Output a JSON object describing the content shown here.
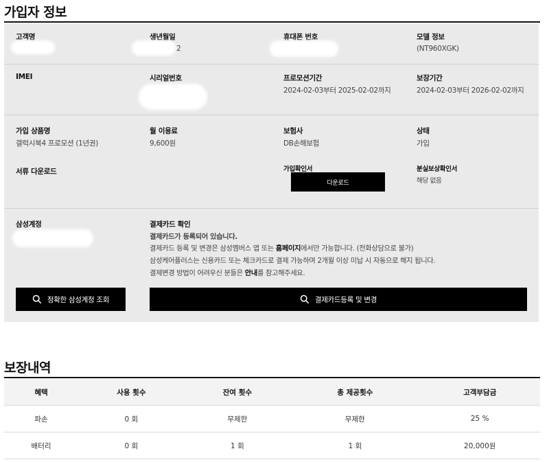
{
  "subscriber": {
    "title": "가입자 정보",
    "customer_name_label": "고객명",
    "birth_label": "생년월일",
    "birth_visible_fragment": "2",
    "phone_label": "휴대폰 번호",
    "model_label": "모델 정보",
    "model_value": "(NT960XGK)",
    "imei_label": "IMEI",
    "serial_label": "시리얼번호",
    "promo_period_label": "프로모션기간",
    "promo_period_value": "2024-02-03부터 2025-02-02까지",
    "warranty_label": "보장기간",
    "warranty_value": "2024-02-03부터 2026-02-02까지",
    "product_label": "가입 상품명",
    "product_value": "갤럭시북4 프로모션 (1년권)",
    "fee_label": "월 이용료",
    "fee_value": "9,600원",
    "insurer_label": "보험사",
    "insurer_value": "DB손해보험",
    "status_label": "상태",
    "status_value": "가입",
    "docs_label": "서류 다운로드",
    "join_cert_label": "가입확인서",
    "download_button": "다운로드",
    "loss_cert_label": "분실보상확인서",
    "loss_cert_value": "해당 없음",
    "samsung_account_label": "삼성계정",
    "payment_card_label": "결제카드 확인",
    "payment_registered": "결제카드가 등록되어 있습니다.",
    "payment_line2_a": "결제카드 등록 및 변경은 삼성멤버스 앱 또는 ",
    "payment_line2_b": "홈페이지",
    "payment_line2_c": "에서만 가능합니다. (전화상담으로 불가)",
    "payment_line3": "삼성케어플러스는 신용카드 또는 체크카드로 결제 가능하며 2개월 이상 미납 시 자동으로 해지 됩니다.",
    "payment_line4_a": "결제변경 방법이 어려우신 분들은 ",
    "payment_line4_b": "안내",
    "payment_line4_c": "를 참고해주세요.",
    "account_lookup_button": "정확한 삼성계정 조회",
    "card_change_button": "결제카드등록 및 변경"
  },
  "coverage": {
    "title": "보장내역",
    "headers": [
      "혜택",
      "사용 횟수",
      "잔여 횟수",
      "총 제공횟수",
      "고객부담금"
    ],
    "rows": [
      [
        "파손",
        "0 회",
        "무제한",
        "무제한",
        "25 %"
      ],
      [
        "배터리",
        "0 회",
        "1 회",
        "1 회",
        "20,000원"
      ]
    ]
  },
  "icons": {
    "search": "search-icon"
  },
  "colors": {
    "accent_black": "#000000",
    "warning_red": "#d40000",
    "panel_gray": "#eaeaea"
  }
}
